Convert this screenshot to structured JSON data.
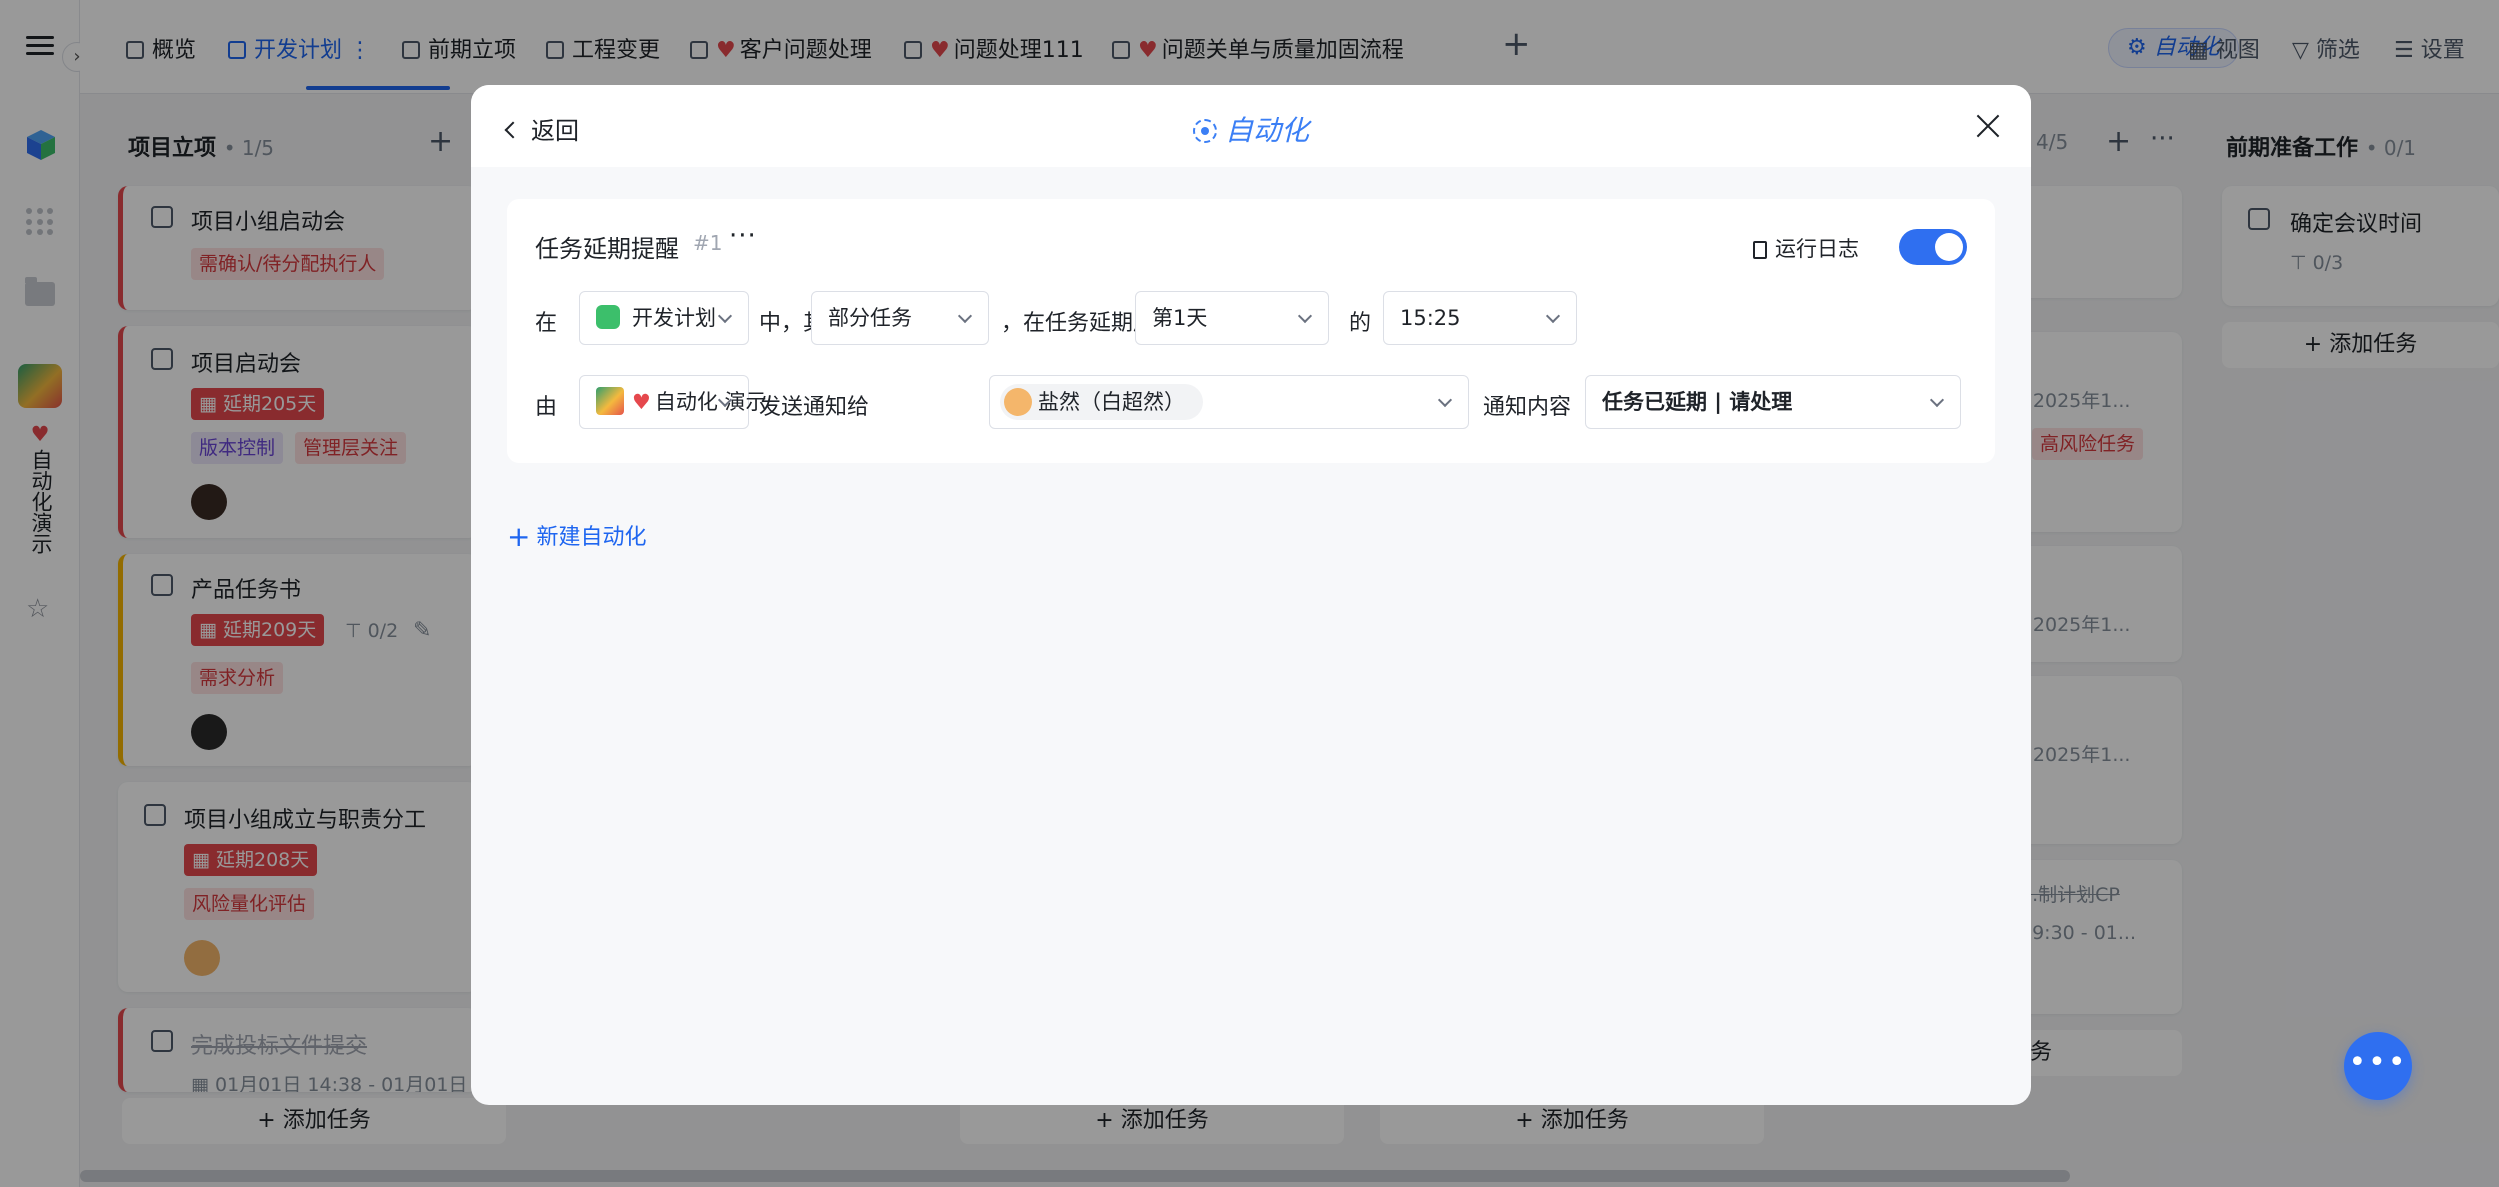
{
  "sidebar": {
    "workspace_label": "自动化演示"
  },
  "tabs": [
    {
      "label": "概览"
    },
    {
      "label": "开发计划",
      "active": true
    },
    {
      "label": "前期立项"
    },
    {
      "label": "工程变更"
    },
    {
      "label": "客户问题处理",
      "heart": true
    },
    {
      "label": "问题处理111",
      "heart": true
    },
    {
      "label": "问题关单与质量加固流程",
      "heart": true
    }
  ],
  "toolbar": {
    "automation": "自动化",
    "view": "视图",
    "filter": "筛选",
    "settings": "设置"
  },
  "board": {
    "col1": {
      "title": "项目立项",
      "count": "• 1/5",
      "cards": [
        {
          "title": "项目小组启动会",
          "tags": [
            "需确认/待分配执行人"
          ]
        },
        {
          "title": "项目启动会",
          "overdue": "延期205天",
          "tags": [
            "版本控制",
            "管理层关注"
          ]
        },
        {
          "title": "产品任务书",
          "overdue": "延期209天",
          "subtasks": "0/2",
          "tags": [
            "需求分析"
          ]
        },
        {
          "title": "项目小组成立与职责分工",
          "overdue": "延期208天",
          "tags": [
            "风险量化评估"
          ]
        },
        {
          "title": "完成投标文件提交",
          "date": "01月01日 14:38 - 01月01日 ..."
        }
      ],
      "add_task": "添加任务"
    },
    "col3_add_task": "添加任务",
    "col4": {
      "count": "4/5",
      "cards": [
        {
          "date": "- 2025年1..."
        },
        {
          "tag": "高风险任务"
        },
        {
          "date": "- 2025年1..."
        },
        {
          "date": "- 2025年1..."
        },
        {
          "title": "...制计划CP",
          "date": "09:30 - 01..."
        }
      ],
      "add_task": "添加任务",
      "partial": "务"
    },
    "col5": {
      "title": "前期准备工作",
      "count": "• 0/1",
      "cards": [
        {
          "title": "确定会议时间",
          "subtasks": "0/3"
        }
      ],
      "add_task": "添加任务"
    }
  },
  "modal": {
    "back": "返回",
    "title": "自动化",
    "rule": {
      "name": "任务延期提醒",
      "number": "#1",
      "more": "···",
      "run_log": "运行日志",
      "enabled": true,
      "row1": {
        "in": "在",
        "project": "开发计划",
        "among": "中，其",
        "scope": "部分任务",
        "after_overdue": "，在任务延期后",
        "day": "第1天",
        "of": "的",
        "time": "15:25"
      },
      "row2": {
        "by": "由",
        "sender": "自动化 演示",
        "send_to": "发送通知给",
        "recipient": "盐然（白超然）",
        "content_label": "通知内容",
        "content": "任务已延期 | 请处理"
      }
    },
    "new_automation": "新建自动化"
  },
  "fab": "•••"
}
